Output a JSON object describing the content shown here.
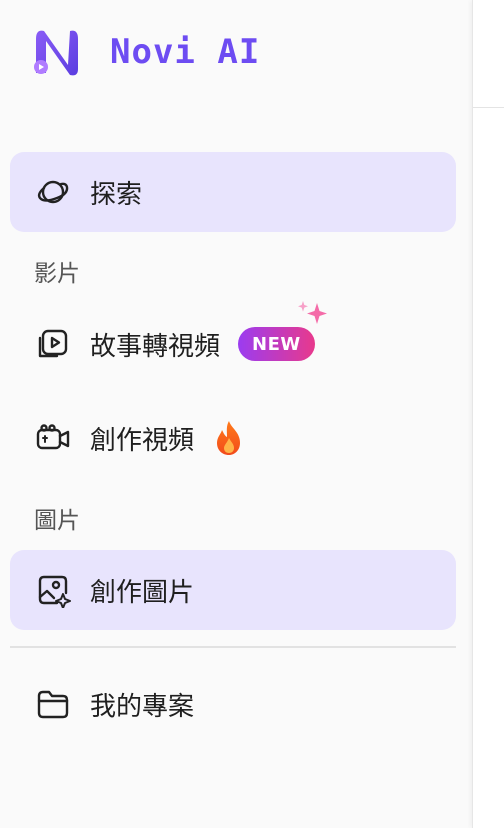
{
  "brand": {
    "name": "Novi AI",
    "color": "#6d4cf2"
  },
  "nav": {
    "explore": {
      "label": "探索",
      "icon": "planet-icon"
    },
    "video_section": "影片",
    "story_to_video": {
      "label": "故事轉視頻",
      "icon": "video-frame-play-icon",
      "badge": "NEW"
    },
    "create_video": {
      "label": "創作視頻",
      "icon": "video-camera-icon",
      "badge_icon": "fire-icon"
    },
    "image_section": "圖片",
    "create_image": {
      "label": "創作圖片",
      "icon": "image-sparkle-icon"
    },
    "my_projects": {
      "label": "我的專案",
      "icon": "folder-icon"
    }
  },
  "colors": {
    "active_bg": "#e8e4fd",
    "badge_start": "#9b3cf0",
    "badge_end": "#e8398c"
  }
}
